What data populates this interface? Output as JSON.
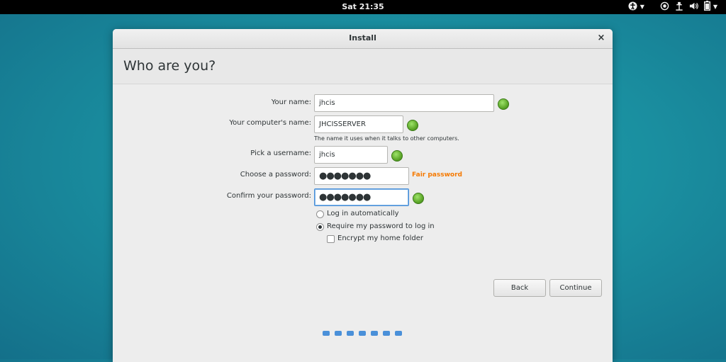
{
  "topbar": {
    "clock": "Sat 21:35",
    "icons": [
      "accessibility-icon",
      "chevron-down-icon",
      "network-icon",
      "volume-icon",
      "battery-icon",
      "chevron-down-icon"
    ]
  },
  "window": {
    "title": "Install",
    "close_glyph": "×"
  },
  "page": {
    "heading": "Who are you?"
  },
  "form": {
    "your_name_label": "Your name:",
    "your_name_value": "jhcis",
    "computer_name_label": "Your computer's name:",
    "computer_name_value": "JHCISSERVER",
    "computer_name_hint": "The name it uses when it talks to other computers.",
    "username_label": "Pick a username:",
    "username_value": "jhcis",
    "password_label": "Choose a password:",
    "password_masked": "●●●●●●●",
    "password_strength": "Fair password",
    "confirm_label": "Confirm your password:",
    "confirm_masked": "●●●●●●●"
  },
  "options": {
    "auto_login": "Log in automatically",
    "require_password": "Require my password to log in",
    "encrypt_home": "Encrypt my home folder",
    "selected": "require_password"
  },
  "buttons": {
    "back": "Back",
    "continue": "Continue"
  },
  "progress": {
    "steps": 7
  },
  "colors": {
    "accent": "#4a90d9",
    "strength_warning": "#f57900",
    "valid_green": "#5ea82a"
  }
}
